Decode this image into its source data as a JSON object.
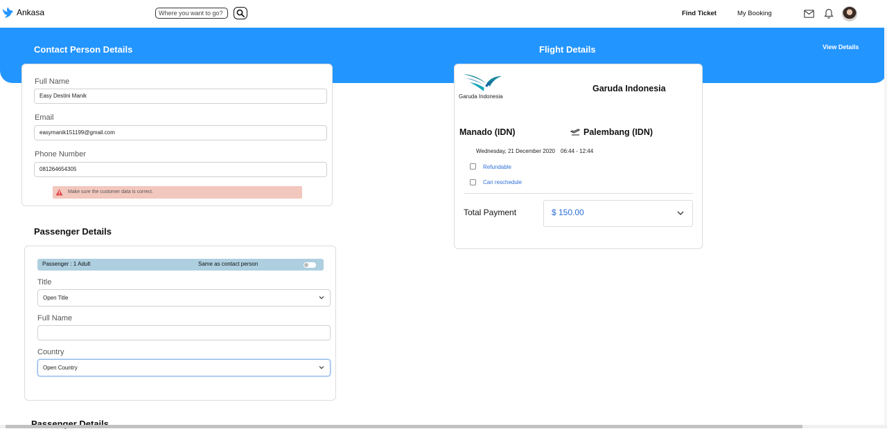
{
  "app": {
    "name": "Ankasa"
  },
  "nav": {
    "search_placeholder": "Where you want to go?",
    "find_ticket": "Find Ticket",
    "my_booking": "My Booking"
  },
  "banner": {
    "contact_title": "Contact Person Details",
    "flight_title": "Flight Details",
    "view_details": "View Details"
  },
  "contact": {
    "full_name_label": "Full Name",
    "full_name_value": "Easy Destini Manik",
    "email_label": "Email",
    "email_value": "easymanik151199@gmail.com",
    "phone_label": "Phone Number",
    "phone_value": "081264654305",
    "warning": "Make sure the customer data is correct."
  },
  "passenger": {
    "section_title": "Passenger Details",
    "bar_left": "Passenger : 1 Adult",
    "bar_mid": "Same as contact person",
    "same_as_contact": false,
    "title_label": "Title",
    "title_value": "Open Title",
    "full_name_label": "Full Name",
    "full_name_value": "",
    "country_label": "Country",
    "country_value": "Open Country",
    "next_section_title": "Passenger Details"
  },
  "flight": {
    "airline_logo_text": "Garuda Indonesia",
    "airline_name": "Garuda Indonesia",
    "from": "Manado (IDN)",
    "to": "Palembang (IDN)",
    "date": "Wednesday, 21 December 2020",
    "time": "06:44 - 12:44",
    "refundable": "Refundable",
    "reschedule": "Can reschedule",
    "total_label": "Total Payment",
    "total_value": "$ 150.00"
  },
  "colors": {
    "primary": "#2395ff",
    "link": "#2b6fd8",
    "warning_bg": "#f2c7bd",
    "passenger_bar": "#aecfe0"
  }
}
